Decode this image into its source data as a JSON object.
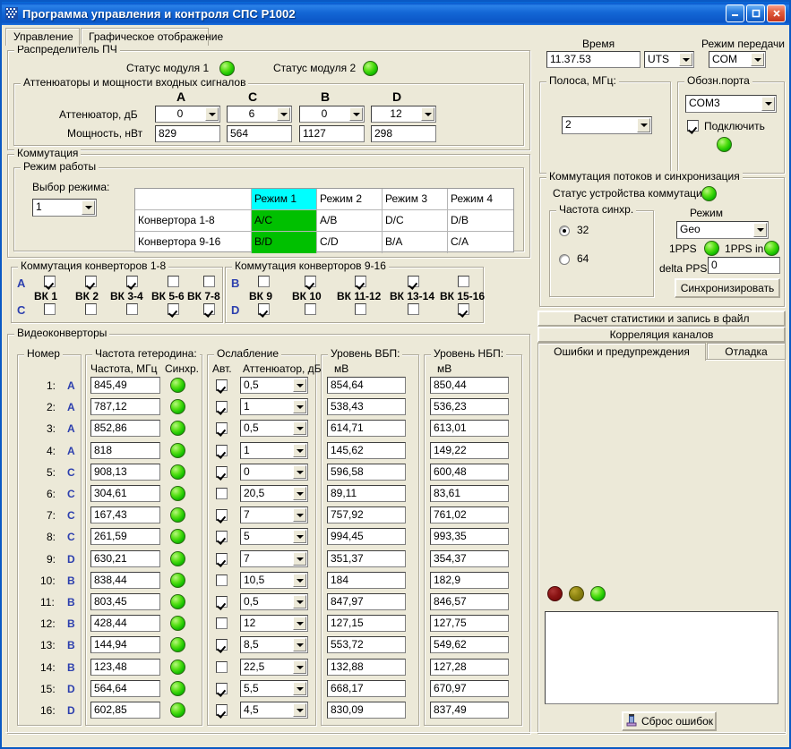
{
  "window": {
    "title": "Программа управления и контроля СПС Р1002",
    "icon": "app-icon",
    "minimize": "_",
    "maximize": "□",
    "close": "✕"
  },
  "tabs": [
    {
      "label": "Управление",
      "active": true
    },
    {
      "label": "Графическое отображение",
      "active": false
    }
  ],
  "distributor": {
    "caption": "Распределитель ПЧ",
    "module1_label": "Статус модуля 1",
    "module1_led": "green",
    "module2_label": "Статус модуля 2",
    "module2_led": "green",
    "attenuators": {
      "caption": "Аттенюаторы и мощности входных сигналов",
      "row_atten_label": "Аттенюатор, дБ",
      "row_power_label": "Мощность, нВт",
      "channels": [
        "A",
        "C",
        "B",
        "D"
      ],
      "atten_values": [
        "0",
        "6",
        "0",
        "12"
      ],
      "power_values": [
        "829",
        "564",
        "1127",
        "298"
      ]
    }
  },
  "commutation": {
    "caption": "Коммутация",
    "mode_group_caption": "Режим работы",
    "mode_select_label": "Выбор режима:",
    "mode_select_value": "1",
    "table": {
      "header": [
        "",
        "Режим 1",
        "Режим 2",
        "Режим 3",
        "Режим 4"
      ],
      "rows": [
        {
          "label": "Конвертора 1-8",
          "cells": [
            "A/C",
            "A/B",
            "D/C",
            "D/B"
          ]
        },
        {
          "label": "Конвертора 9-16",
          "cells": [
            "B/D",
            "C/D",
            "B/A",
            "C/A"
          ]
        }
      ],
      "highlight_column": 1,
      "highlight_header_color": "#00ffff",
      "highlight_cell_color": "#00c000"
    }
  },
  "conv_switch_1_8": {
    "caption": "Коммутация конверторов 1-8",
    "top_letter": "A",
    "bottom_letter": "C",
    "labels": [
      "ВК 1",
      "ВК 2",
      "ВК 3-4",
      "ВК 5-6",
      "ВК 7-8"
    ],
    "top_checked": [
      true,
      true,
      true,
      false,
      false
    ],
    "bottom_checked": [
      false,
      false,
      false,
      true,
      true
    ]
  },
  "conv_switch_9_16": {
    "caption": "Коммутация конверторов 9-16",
    "top_letter": "B",
    "bottom_letter": "D",
    "labels": [
      "ВК 9",
      "ВК 10",
      "ВК 11-12",
      "ВК 13-14",
      "ВК 15-16"
    ],
    "top_checked": [
      false,
      true,
      true,
      true,
      false
    ],
    "bottom_checked": [
      true,
      false,
      false,
      false,
      true
    ]
  },
  "videoconverters": {
    "caption": "Видеоконверторы",
    "col_number": {
      "caption": "Номер"
    },
    "col_freq": {
      "caption": "Частота гетеродина:",
      "sub_freq": "Частота, МГц",
      "sub_sync": "Синхр."
    },
    "col_atten": {
      "caption": "Ослабление",
      "sub_auto": "Авт.",
      "sub_atten": "Аттенюатор, дБ"
    },
    "col_usb": {
      "caption": "Уровень ВБП:",
      "unit": "мВ"
    },
    "col_lsb": {
      "caption": "Уровень НБП:",
      "unit": "мВ"
    },
    "rows": [
      {
        "num": "1:",
        "ch": "A",
        "freq": "845,49",
        "sync": "green",
        "auto": true,
        "atten": "0,5",
        "usb": "854,64",
        "lsb": "850,44"
      },
      {
        "num": "2:",
        "ch": "A",
        "freq": "787,12",
        "sync": "green",
        "auto": true,
        "atten": "1",
        "usb": "538,43",
        "lsb": "536,23"
      },
      {
        "num": "3:",
        "ch": "A",
        "freq": "852,86",
        "sync": "green",
        "auto": true,
        "atten": "0,5",
        "usb": "614,71",
        "lsb": "613,01"
      },
      {
        "num": "4:",
        "ch": "A",
        "freq": "818",
        "sync": "green",
        "auto": true,
        "atten": "1",
        "usb": "145,62",
        "lsb": "149,22"
      },
      {
        "num": "5:",
        "ch": "C",
        "freq": "908,13",
        "sync": "green",
        "auto": true,
        "atten": "0",
        "usb": "596,58",
        "lsb": "600,48"
      },
      {
        "num": "6:",
        "ch": "C",
        "freq": "304,61",
        "sync": "green",
        "auto": false,
        "atten": "20,5",
        "usb": "89,11",
        "lsb": "83,61"
      },
      {
        "num": "7:",
        "ch": "C",
        "freq": "167,43",
        "sync": "green",
        "auto": true,
        "atten": "7",
        "usb": "757,92",
        "lsb": "761,02"
      },
      {
        "num": "8:",
        "ch": "C",
        "freq": "261,59",
        "sync": "green",
        "auto": true,
        "atten": "5",
        "usb": "994,45",
        "lsb": "993,35"
      },
      {
        "num": "9:",
        "ch": "D",
        "freq": "630,21",
        "sync": "green",
        "auto": true,
        "atten": "7",
        "usb": "351,37",
        "lsb": "354,37"
      },
      {
        "num": "10:",
        "ch": "B",
        "freq": "838,44",
        "sync": "green",
        "auto": false,
        "atten": "10,5",
        "usb": "184",
        "lsb": "182,9"
      },
      {
        "num": "11:",
        "ch": "B",
        "freq": "803,45",
        "sync": "green",
        "auto": true,
        "atten": "0,5",
        "usb": "847,97",
        "lsb": "846,57"
      },
      {
        "num": "12:",
        "ch": "B",
        "freq": "428,44",
        "sync": "green",
        "auto": false,
        "atten": "12",
        "usb": "127,15",
        "lsb": "127,75"
      },
      {
        "num": "13:",
        "ch": "B",
        "freq": "144,94",
        "sync": "green",
        "auto": true,
        "atten": "8,5",
        "usb": "553,72",
        "lsb": "549,62"
      },
      {
        "num": "14:",
        "ch": "B",
        "freq": "123,48",
        "sync": "green",
        "auto": false,
        "atten": "22,5",
        "usb": "132,88",
        "lsb": "127,28"
      },
      {
        "num": "15:",
        "ch": "D",
        "freq": "564,64",
        "sync": "green",
        "auto": true,
        "atten": "5,5",
        "usb": "668,17",
        "lsb": "670,97"
      },
      {
        "num": "16:",
        "ch": "D",
        "freq": "602,85",
        "sync": "green",
        "auto": true,
        "atten": "4,5",
        "usb": "830,09",
        "lsb": "837,49"
      }
    ]
  },
  "right": {
    "time_label": "Время",
    "time_value": "11.37.53",
    "time_scale": "UTS",
    "transmit_label": "Режим передачи",
    "transmit_value": "COM",
    "band": {
      "caption": "Полоса, МГц:",
      "value": "2"
    },
    "port": {
      "caption": "Обозн.порта",
      "value": "COM3",
      "connect_label": "Подключить",
      "connect_checked": true,
      "led": "green"
    },
    "sync": {
      "caption": "Коммутация потоков и синхронизация",
      "status_label": "Статус устройства коммутации",
      "status_led": "green",
      "freq_caption": "Частота синхр.",
      "freq_options": [
        "32",
        "64"
      ],
      "freq_selected": "32",
      "mode_label": "Режим",
      "mode_value": "Geo",
      "pps_out_label": "1PPS",
      "pps_out_led": "green",
      "pps_in_label": "1PPS in",
      "pps_in_led": "green",
      "delta_label": "delta PPS",
      "delta_value": "0",
      "sync_button": "Синхронизировать"
    },
    "buttons": {
      "stats": "Расчет статистики и запись в файл",
      "correlation": "Корреляция каналов"
    },
    "log_tabs": [
      {
        "label": "Ошибки и предупреждения",
        "active": true
      },
      {
        "label": "Отладка",
        "active": false
      }
    ],
    "log_leds": [
      "red",
      "yellow",
      "green"
    ],
    "log_text": "",
    "reset_button": "Сброс ошибок",
    "reset_icon": "reset-icon"
  }
}
